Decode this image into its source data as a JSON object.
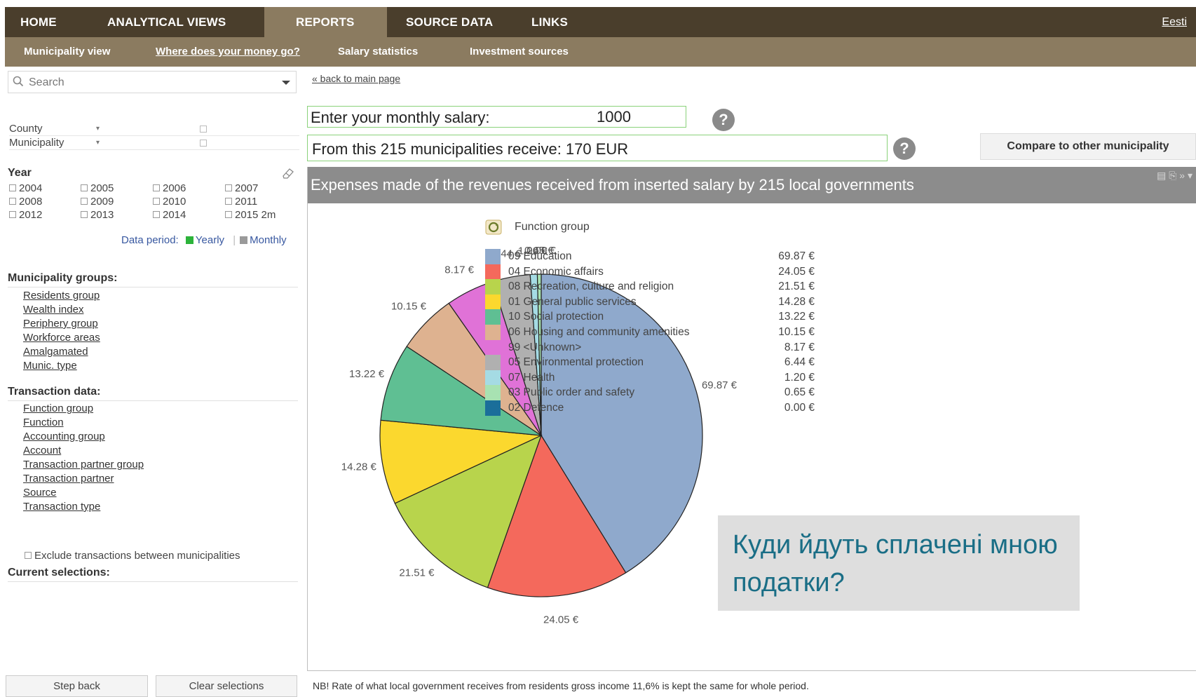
{
  "topnav": {
    "items": [
      {
        "label": "HOME"
      },
      {
        "label": "ANALYTICAL VIEWS"
      },
      {
        "label": "REPORTS"
      },
      {
        "label": "SOURCE DATA"
      },
      {
        "label": "LINKS"
      }
    ],
    "active": "REPORTS",
    "language_link": "Eesti"
  },
  "subnav": {
    "items": [
      {
        "label": "Municipality view"
      },
      {
        "label": "Where does your money go?"
      },
      {
        "label": "Salary statistics"
      },
      {
        "label": "Investment sources"
      }
    ]
  },
  "sidebar": {
    "search_placeholder": "Search",
    "filters": [
      {
        "label": "County"
      },
      {
        "label": "Municipality"
      }
    ],
    "year_label": "Year",
    "years": [
      "2004",
      "2005",
      "2006",
      "2007",
      "2008",
      "2009",
      "2010",
      "2011",
      "2012",
      "2013",
      "2014",
      "2015 2m"
    ],
    "data_period_label": "Data period:",
    "data_period_yearly": "Yearly",
    "data_period_monthly": "Monthly",
    "municipality_groups_title": "Municipality groups:",
    "municipality_groups": [
      "Residents group",
      "Wealth index",
      "Periphery group",
      "Workforce areas",
      "Amalgamated",
      "Munic. type"
    ],
    "transaction_data_title": "Transaction data:",
    "transaction_data": [
      "Function group",
      "Function",
      "Accounting group",
      "Account",
      "Transaction partner group",
      "Transaction partner",
      "Source",
      "Transaction type"
    ],
    "exclude_label": "Exclude transactions between municipalities",
    "current_selections_title": "Current selections:",
    "step_back_label": "Step back",
    "clear_selections_label": "Clear selections"
  },
  "main": {
    "back_link": "« back to main page",
    "salary_label": "Enter your monthly salary:",
    "salary_value": "1000",
    "receive_text": "From this 215 municipalities receive: 170 EUR",
    "help_glyph": "?",
    "compare_button": "Compare to other municipality",
    "chart_panel_title": "Expenses made of the revenues received from inserted salary by 215 local governments",
    "overlay_text": "Куди йдуть сплачені мною податки?",
    "footnote": "NB! Rate of what local government receives from residents gross income 11,6% is kept the same for whole period."
  },
  "colors": {
    "topnav_bg": "#4a3e2c",
    "subnav_bg": "#8b7b60",
    "chart_header_bg": "#8c8c8c",
    "input_border": "#8ad27a",
    "overlay_text": "#1a6e86"
  },
  "chart_data": {
    "type": "pie",
    "legend_title": "Function group",
    "legend_position": "right",
    "series": [
      {
        "name": "09 Education",
        "value": 69.87,
        "label": "69.87 €",
        "color": "#8fa9cc"
      },
      {
        "name": "04 Economic affairs",
        "value": 24.05,
        "label": "24.05 €",
        "color": "#f4695c"
      },
      {
        "name": "08 Recreation, culture and religion",
        "value": 21.51,
        "label": "21.51 €",
        "color": "#b8d44c"
      },
      {
        "name": "01 General public services",
        "value": 14.28,
        "label": "14.28 €",
        "color": "#fbd82e"
      },
      {
        "name": "10 Social protection",
        "value": 13.22,
        "label": "13.22 €",
        "color": "#5fbf93"
      },
      {
        "name": "06 Housing and community amenities",
        "value": 10.15,
        "label": "10.15 €",
        "color": "#deb290"
      },
      {
        "name": "99 <Unknown>",
        "value": 8.17,
        "label": "8.17 €",
        "color": "#e072d7"
      },
      {
        "name": "05 Environmental protection",
        "value": 6.44,
        "label": "6.44 €",
        "color": "#b0b0b0"
      },
      {
        "name": "07 Health",
        "value": 1.2,
        "label": "1.20 €",
        "color": "#a5dbe4"
      },
      {
        "name": "03 Public order and safety",
        "value": 0.65,
        "label": "0.65 €",
        "color": "#a8e2b2"
      },
      {
        "name": "02 Defence",
        "value": 0.0,
        "label": "0.00 €",
        "color": "#1b6e9a"
      }
    ]
  }
}
